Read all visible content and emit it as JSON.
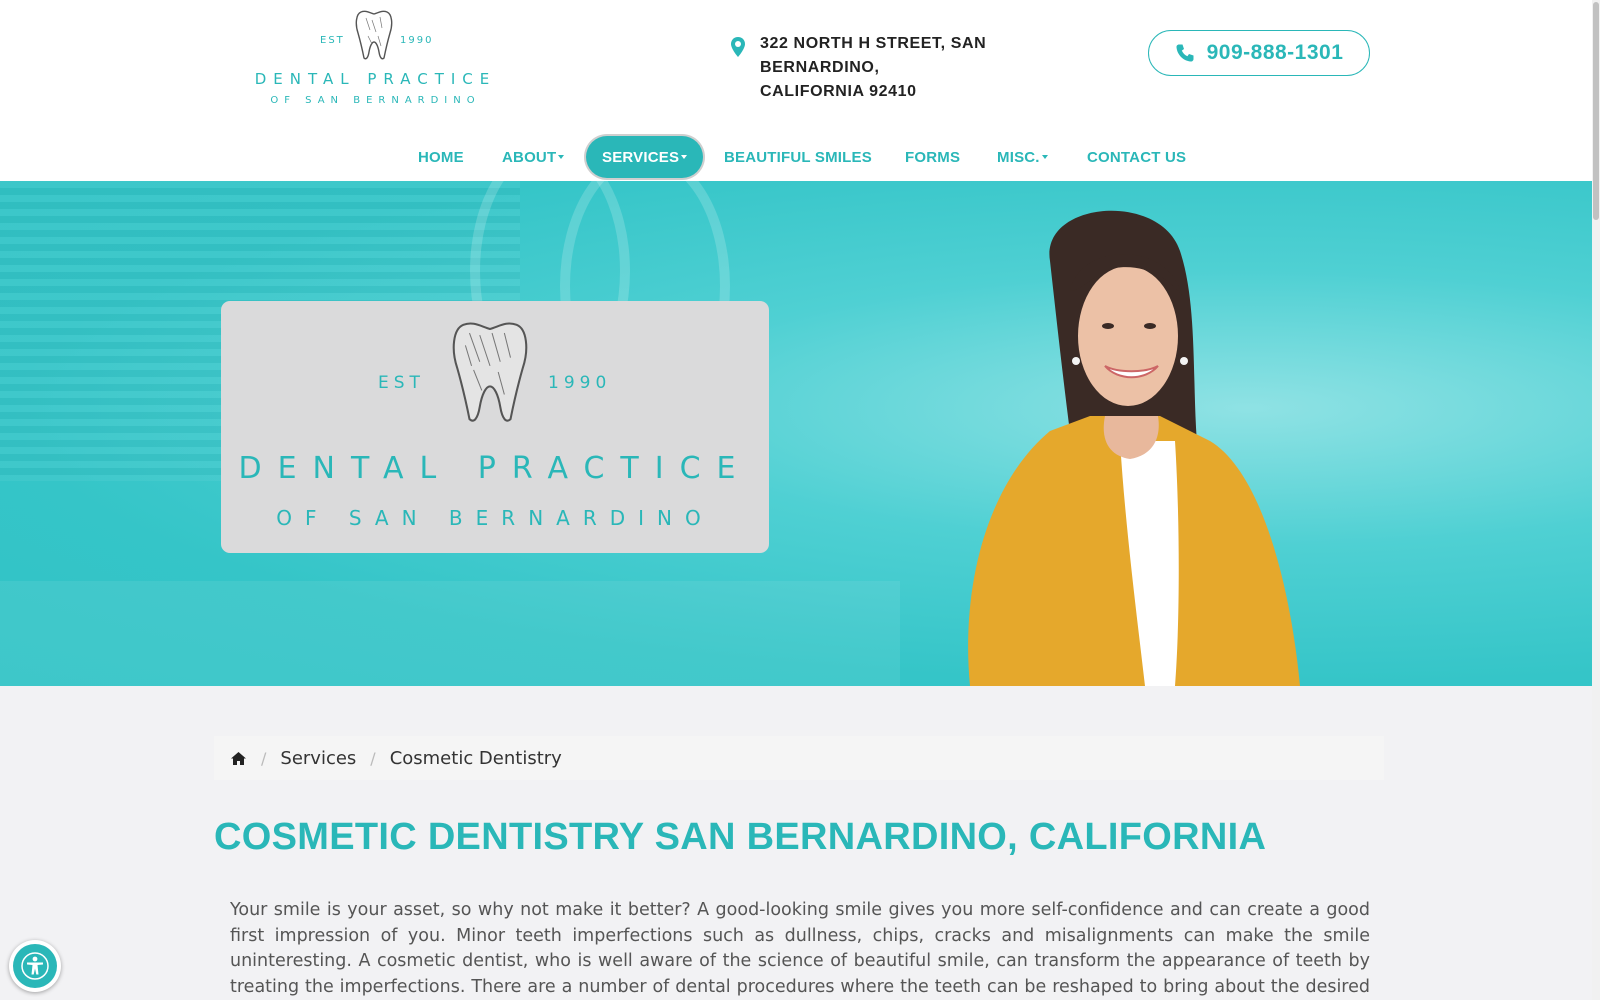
{
  "brand": {
    "est_left": "EST",
    "est_right": "1990",
    "name": "DENTAL PRACTICE",
    "subname": "OF SAN BERNARDINO"
  },
  "header": {
    "address_line1": "322 North H Street, San Bernardino,",
    "address_line2": "California 92410",
    "phone": "909-888-1301"
  },
  "nav": [
    {
      "label": "Home",
      "dropdown": false,
      "active": false
    },
    {
      "label": "About",
      "dropdown": true,
      "active": false
    },
    {
      "label": "Services",
      "dropdown": true,
      "active": true
    },
    {
      "label": "Beautiful Smiles",
      "dropdown": false,
      "active": false
    },
    {
      "label": "Forms",
      "dropdown": false,
      "active": false
    },
    {
      "label": "Misc.",
      "dropdown": true,
      "active": false
    },
    {
      "label": "Contact Us",
      "dropdown": false,
      "active": false
    }
  ],
  "breadcrumb": [
    "Services",
    "Cosmetic Dentistry"
  ],
  "page_title": "COSMETIC DENTISTRY SAN BERNARDINO, CALIFORNIA",
  "body_text": "Your smile is your asset, so why not make it better? A good-looking smile gives you more self-confidence and can create a good first impression of you. Minor teeth imperfections such as dullness, chips, cracks and misalignments can make the smile uninteresting. A cosmetic dentist, who is well aware of the science of beautiful smile, can transform the appearance of teeth by treating the imperfections. There are a number of dental procedures where the teeth can be reshaped to bring about the desired changes. The",
  "colors": {
    "accent": "#2ab7b8",
    "hero_bg": "#35c5c8",
    "page_bg": "#f2f2f4"
  },
  "icons": {
    "pin": "map-pin-icon",
    "phone": "phone-icon",
    "home": "home-icon",
    "accessibility": "accessibility-icon"
  }
}
